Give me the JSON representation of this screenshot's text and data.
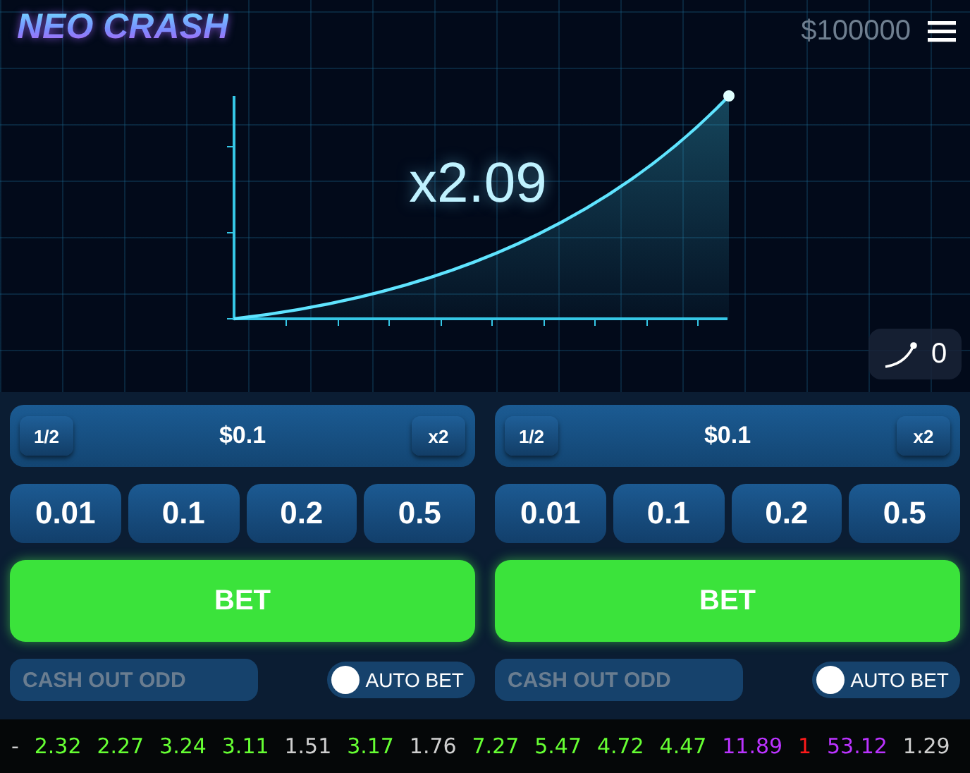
{
  "header": {
    "logo": "NEO CRASH",
    "balance": "$100000"
  },
  "round": {
    "multiplier": "x2.09",
    "counter": "0"
  },
  "bet_panels": [
    {
      "half_label": "1/2",
      "amount": "$0.1",
      "double_label": "x2",
      "chips": [
        "0.01",
        "0.1",
        "0.2",
        "0.5"
      ],
      "bet_label": "BET",
      "cash_out": {
        "placeholder": "CASH OUT ODD"
      },
      "auto_bet": {
        "label": "AUTO BET",
        "on": false
      }
    },
    {
      "half_label": "1/2",
      "amount": "$0.1",
      "double_label": "x2",
      "chips": [
        "0.01",
        "0.1",
        "0.2",
        "0.5"
      ],
      "bet_label": "BET",
      "cash_out": {
        "placeholder": "CASH OUT ODD"
      },
      "auto_bet": {
        "label": "AUTO BET",
        "on": false
      }
    }
  ],
  "history": [
    {
      "value": "-",
      "color": "#cfcfcf"
    },
    {
      "value": "2.32",
      "color": "#66ff33"
    },
    {
      "value": "2.27",
      "color": "#66ff33"
    },
    {
      "value": "3.24",
      "color": "#66ff33"
    },
    {
      "value": "3.11",
      "color": "#66ff33"
    },
    {
      "value": "1.51",
      "color": "#cfcfcf"
    },
    {
      "value": "3.17",
      "color": "#66ff33"
    },
    {
      "value": "1.76",
      "color": "#cfcfcf"
    },
    {
      "value": "7.27",
      "color": "#66ff33"
    },
    {
      "value": "5.47",
      "color": "#66ff33"
    },
    {
      "value": "4.72",
      "color": "#66ff33"
    },
    {
      "value": "4.47",
      "color": "#66ff33"
    },
    {
      "value": "11.89",
      "color": "#bb33ff"
    },
    {
      "value": "1",
      "color": "#ff1a1a"
    },
    {
      "value": "53.12",
      "color": "#bb33ff"
    },
    {
      "value": "1.29",
      "color": "#cfcfcf"
    }
  ]
}
